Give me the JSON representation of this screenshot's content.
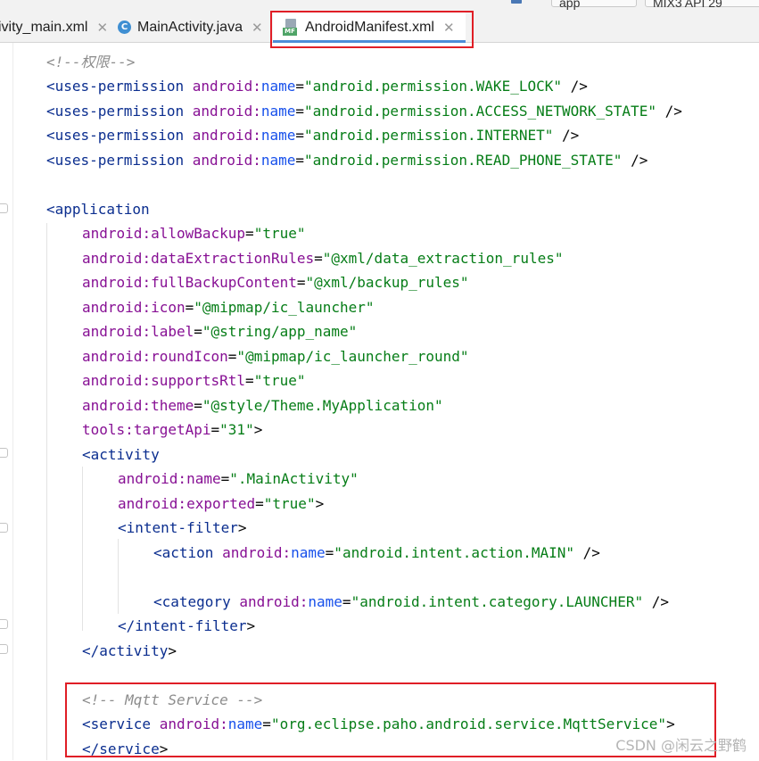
{
  "toolbar_fragment": {
    "run_config": "app",
    "device": "MIX3 API 29"
  },
  "tabs": [
    {
      "label": "ivity_main.xml",
      "active": false
    },
    {
      "label": "MainActivity.java",
      "active": false
    },
    {
      "label": "AndroidManifest.xml",
      "active": true
    }
  ],
  "java_icon_letter": "C",
  "manifest_icon_letters": "MF",
  "close_glyph": "✕",
  "code": {
    "comment_permissions": "<!--权限-->",
    "permissions": [
      "android.permission.WAKE_LOCK",
      "android.permission.ACCESS_NETWORK_STATE",
      "android.permission.INTERNET",
      "android.permission.READ_PHONE_STATE"
    ],
    "application_attrs": [
      {
        "ns": "android",
        "name": "allowBackup",
        "value": "true"
      },
      {
        "ns": "android",
        "name": "dataExtractionRules",
        "value": "@xml/data_extraction_rules"
      },
      {
        "ns": "android",
        "name": "fullBackupContent",
        "value": "@xml/backup_rules"
      },
      {
        "ns": "android",
        "name": "icon",
        "value": "@mipmap/ic_launcher"
      },
      {
        "ns": "android",
        "name": "label",
        "value": "@string/app_name"
      },
      {
        "ns": "android",
        "name": "roundIcon",
        "value": "@mipmap/ic_launcher_round"
      },
      {
        "ns": "android",
        "name": "supportsRtl",
        "value": "true"
      },
      {
        "ns": "android",
        "name": "theme",
        "value": "@style/Theme.MyApplication"
      },
      {
        "ns": "tools",
        "name": "targetApi",
        "value": "31"
      }
    ],
    "activity_name": ".MainActivity",
    "activity_exported": "true",
    "intent_action": "android.intent.action.MAIN",
    "intent_category": "android.intent.category.LAUNCHER",
    "comment_service": "<!-- Mqtt Service -->",
    "service_name": "org.eclipse.paho.android.service.MqttService"
  },
  "colors": {
    "tag": "#0b2e8f",
    "attribute": "#871094",
    "value": "#067d17",
    "comment": "#8c8c8c",
    "highlight": "#e01e26",
    "tab_underline": "#4d8cd6"
  },
  "watermark": "CSDN @闲云之野鹤"
}
